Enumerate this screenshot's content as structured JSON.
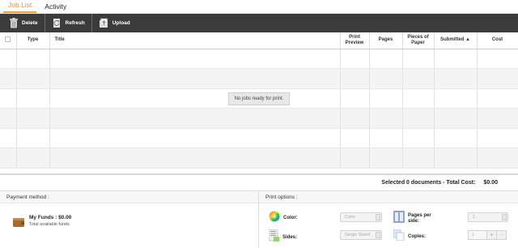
{
  "tabs": [
    {
      "label": "Job List",
      "active": true
    },
    {
      "label": "Activity",
      "active": false
    }
  ],
  "toolbar": {
    "delete_label": "Delete",
    "refresh_label": "Refresh",
    "upload_label": "Upload",
    "background": "#3b3b3b"
  },
  "table": {
    "columns": [
      "",
      "Type",
      "Title",
      "Print Preview",
      "Pages",
      "Pieces of Paper",
      "Submitted",
      "Cost"
    ],
    "sorted_column": "Submitted",
    "sort_direction": "ascending",
    "empty_message": "No jobs ready for print.",
    "rows": []
  },
  "summary": {
    "text": "Selected 0 documents - Total Cost:",
    "total": "$0.00"
  },
  "payment": {
    "heading": "Payment method :",
    "funds_title": "My Funds : $0.00",
    "funds_subtitle": "Total available funds"
  },
  "print_options": {
    "heading": "Print options :",
    "color_label": "Color:",
    "color_value": "Color",
    "sides_label": "Sides:",
    "sides_value": "Single Sided",
    "pages_per_side_label": "Pages per side:",
    "pages_per_side_value": "1",
    "copies_label": "Copies:",
    "copies_value": "1",
    "plus": "+",
    "minus": "-"
  },
  "colors": {
    "accent": "#f0a030",
    "toolbar": "#3b3b3b"
  }
}
